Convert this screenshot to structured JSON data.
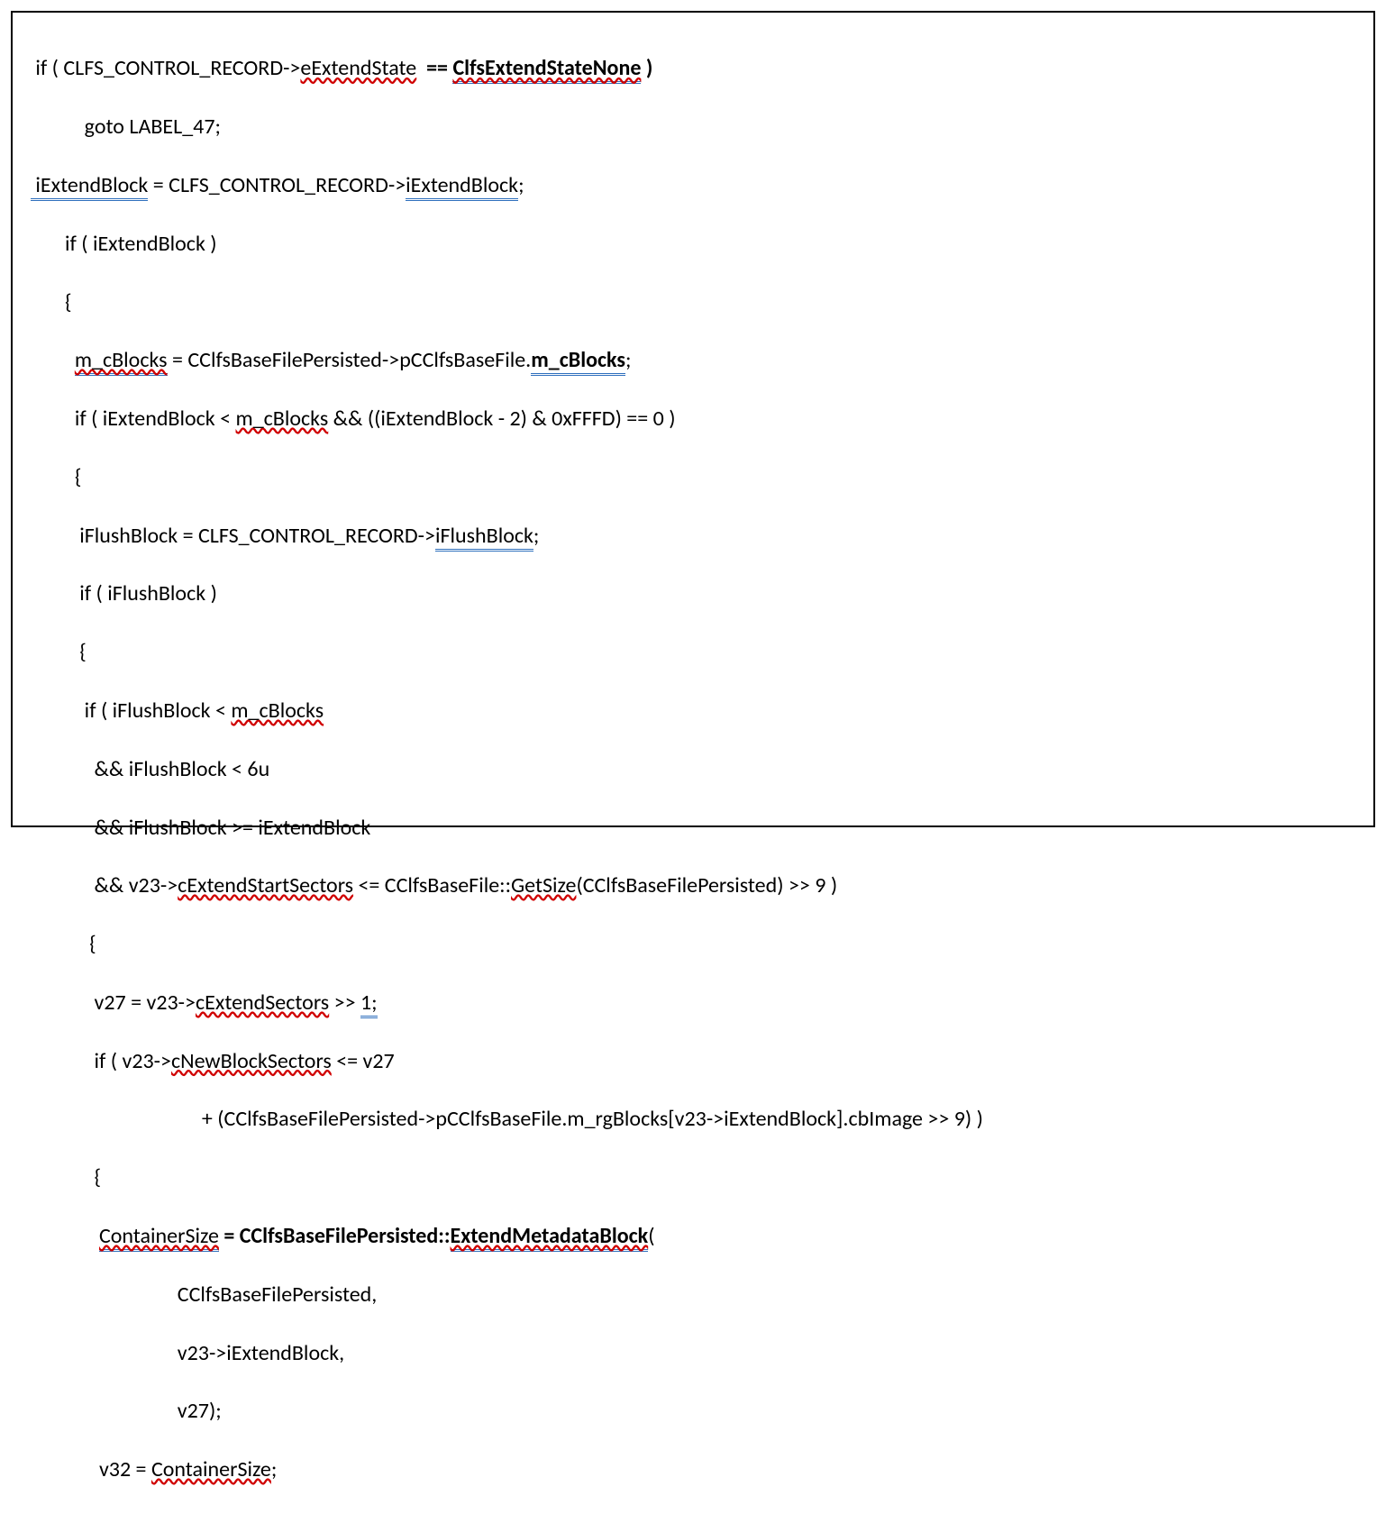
{
  "code": {
    "l1_a": " if ( CLFS_CONTROL_RECORD->",
    "l1_b": "eExtendState",
    "l1_c": "  ",
    "l1_d": "== ",
    "l1_e": "ClfsExtendStateNone",
    "l1_f": " )",
    "l2": "           goto LABEL_47;",
    "l3_a": " iExtendBlock",
    "l3_b": " = CLFS_CONTROL_RECORD->",
    "l3_c": "iExtendBlock",
    "l3_d": ";",
    "l4": "       if ( iExtendBlock )",
    "l5": "       {",
    "l6_a": "         ",
    "l6_b": "m_cBlocks",
    "l6_c": " = CClfsBaseFilePersisted->pCClfsBaseFile.",
    "l6_d": "m_cBlocks",
    "l6_e": ";",
    "l7_a": "         if ( iExtendBlock < ",
    "l7_b": "m_cBlocks",
    "l7_c": " && ((iExtendBlock - 2) & 0xFFFD) == 0 )",
    "l8": "         {",
    "l9_a": "          iFlushBlock = CLFS_CONTROL_RECORD->",
    "l9_b": "iFlushBlock",
    "l9_c": ";",
    "l10": "          if ( iFlushBlock )",
    "l11": "          {",
    "l12_a": "           if ( iFlushBlock < ",
    "l12_b": "m_cBlocks",
    "l13": "             && iFlushBlock < 6u",
    "l14": "             && iFlushBlock >= iExtendBlock",
    "l15_a": "             && v23->",
    "l15_b": "cExtendStartSectors",
    "l15_c": " <= CClfsBaseFile::",
    "l15_d": "GetSize",
    "l15_e": "(CClfsBaseFilePersisted) >> 9 )",
    "l16": "            {",
    "l17_a": "             v27 = v23->",
    "l17_b": "cExtendSectors",
    "l17_c": " >> ",
    "l17_d": "1;",
    "l18_a": "             if ( v23->",
    "l18_b": "cNewBlockSectors",
    "l18_c": " <= v27",
    "l19": "                                   + (CClfsBaseFilePersisted->pCClfsBaseFile.m_rgBlocks[v23->iExtendBlock].cbImage >> 9) )",
    "l20": "             {",
    "l21_a": "              ",
    "l21_b": "ContainerSize",
    "l21_c": " = CClfsBaseFilePersisted::",
    "l21_d": "ExtendMetadataBlock",
    "l21_e": "(",
    "l22": "                              CClfsBaseFilePersisted,",
    "l23": "                              v23->iExtendBlock,",
    "l24": "                              v27);",
    "l25_a": "              v32 = ",
    "l25_b": "ContainerSize",
    "l25_c": ";"
  }
}
